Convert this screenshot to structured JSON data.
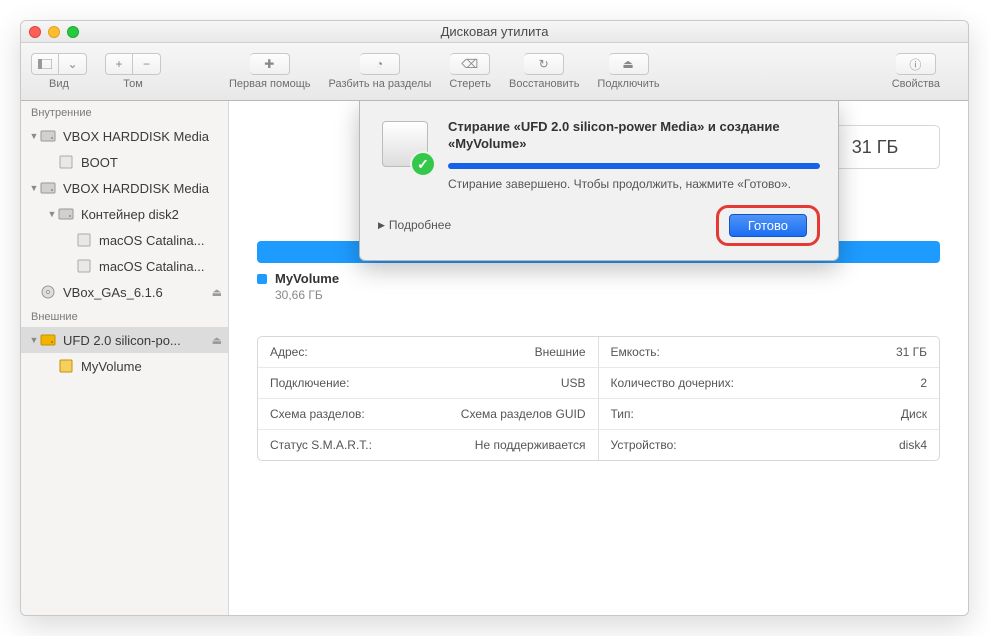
{
  "window": {
    "title": "Дисковая утилита"
  },
  "toolbar": {
    "view": "Вид",
    "volume": "Том",
    "firstaid": "Первая помощь",
    "partition": "Разбить на разделы",
    "erase": "Стереть",
    "restore": "Восстановить",
    "mount": "Подключить",
    "info": "Свойства"
  },
  "sidebar": {
    "internal_header": "Внутренние",
    "external_header": "Внешние",
    "internal": [
      {
        "label": "VBOX HARDDISK Media",
        "indent": 0,
        "arrow": true,
        "icon": "hdd"
      },
      {
        "label": "BOOT",
        "indent": 1,
        "arrow": false,
        "icon": "vol"
      },
      {
        "label": "VBOX HARDDISK Media",
        "indent": 0,
        "arrow": true,
        "icon": "hdd"
      },
      {
        "label": "Контейнер disk2",
        "indent": 1,
        "arrow": true,
        "icon": "hdd"
      },
      {
        "label": "macOS Catalina...",
        "indent": 2,
        "arrow": false,
        "icon": "vol"
      },
      {
        "label": "macOS Catalina...",
        "indent": 2,
        "arrow": false,
        "icon": "vol"
      },
      {
        "label": "VBox_GAs_6.1.6",
        "indent": 0,
        "arrow": false,
        "icon": "cd",
        "eject": true
      }
    ],
    "external": [
      {
        "label": "UFD 2.0 silicon-po...",
        "indent": 0,
        "arrow": true,
        "icon": "ext",
        "eject": true,
        "selected": true
      },
      {
        "label": "MyVolume",
        "indent": 1,
        "arrow": false,
        "icon": "ext-vol"
      }
    ]
  },
  "main": {
    "capacity": "31 ГБ",
    "volume_name": "MyVolume",
    "volume_size": "30,66 ГБ"
  },
  "details": {
    "left": [
      {
        "k": "Адрес:",
        "v": "Внешние"
      },
      {
        "k": "Подключение:",
        "v": "USB"
      },
      {
        "k": "Схема разделов:",
        "v": "Схема разделов GUID"
      },
      {
        "k": "Статус S.M.A.R.T.:",
        "v": "Не поддерживается"
      }
    ],
    "right": [
      {
        "k": "Емкость:",
        "v": "31 ГБ"
      },
      {
        "k": "Количество дочерних:",
        "v": "2"
      },
      {
        "k": "Тип:",
        "v": "Диск"
      },
      {
        "k": "Устройство:",
        "v": "disk4"
      }
    ]
  },
  "sheet": {
    "title": "Стирание «UFD 2.0 silicon-power Media» и создание «MyVolume»",
    "message": "Стирание завершено. Чтобы продолжить, нажмите «Готово».",
    "more": "Подробнее",
    "done": "Готово"
  }
}
